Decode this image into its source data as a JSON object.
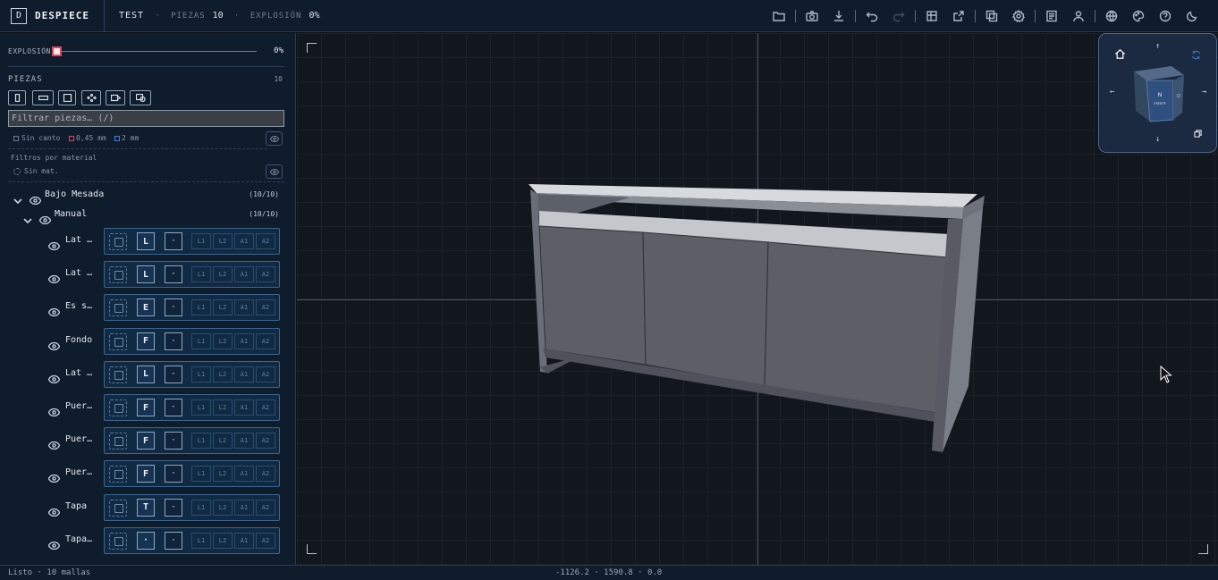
{
  "app": {
    "logo_letter": "D",
    "name": "DESPIECE",
    "project": "TEST",
    "dot": "·",
    "pieces_label": "PIEZAS",
    "pieces_value": "10",
    "explosion_label": "EXPLOSIÓN",
    "explosion_value": "0%"
  },
  "toolbar": {
    "icons": [
      "folder-icon",
      "camera-icon",
      "download-icon",
      "undo-icon",
      "redo-icon",
      "cut-list-icon",
      "export-icon",
      "duplicate-icon",
      "settings-icon",
      "report-icon",
      "user-icon",
      "language-icon",
      "palette-icon",
      "help-icon",
      "theme-moon-icon"
    ]
  },
  "sidebar": {
    "explosion_label": "EXPLOSIÓN",
    "explosion_value": "0%",
    "explosion_fraction": 0,
    "pieces_label": "PIEZAS",
    "pieces_count": "10",
    "filter_placeholder": "Filtrar piezas…  (/)",
    "legend": {
      "no_edge": "Sin canto",
      "edge1": "0,45 mm",
      "edge2": "2 mm",
      "edge1_color": "#e0455a",
      "edge2_color": "#3f7fe0"
    },
    "material_filters_label": "Filtros por material",
    "no_material": "Sin mat.",
    "group": {
      "name": "Bajo Mesada",
      "count": "(10/10)"
    },
    "subgroup": {
      "name": "Manual",
      "count": "(10/10)"
    },
    "edge_labels": [
      "L1",
      "L2",
      "A1",
      "A2"
    ],
    "pieces": [
      {
        "name": "Lat Iz",
        "code": "L",
        "dot": "·"
      },
      {
        "name": "Lat De",
        "code": "L",
        "dot": "·"
      },
      {
        "name": "Es sup",
        "code": "E",
        "dot": "·"
      },
      {
        "name": "Fondo",
        "code": "F",
        "dot": "·"
      },
      {
        "name": "Lat In",
        "code": "L",
        "dot": "·"
      },
      {
        "name": "Puerta",
        "code": "F",
        "dot": "·"
      },
      {
        "name": "Puerta",
        "code": "F",
        "dot": "·"
      },
      {
        "name": "Puerta",
        "code": "F",
        "dot": "·"
      },
      {
        "name": "Tapa",
        "code": "T",
        "dot": "·"
      },
      {
        "name": "Tapa sup",
        "code": "·",
        "dot": "·"
      }
    ]
  },
  "viewport": {
    "navcube": {
      "front": "FRENTE",
      "top_letter": "N",
      "right_letter": "D"
    }
  },
  "status": {
    "left": "Listo · 10 mallas",
    "coords": "-1126.2 · 1590.8 · 0.0"
  },
  "colors": {
    "accent": "#e0455a",
    "panel": "#0f1c2c",
    "card": "#112a44"
  }
}
